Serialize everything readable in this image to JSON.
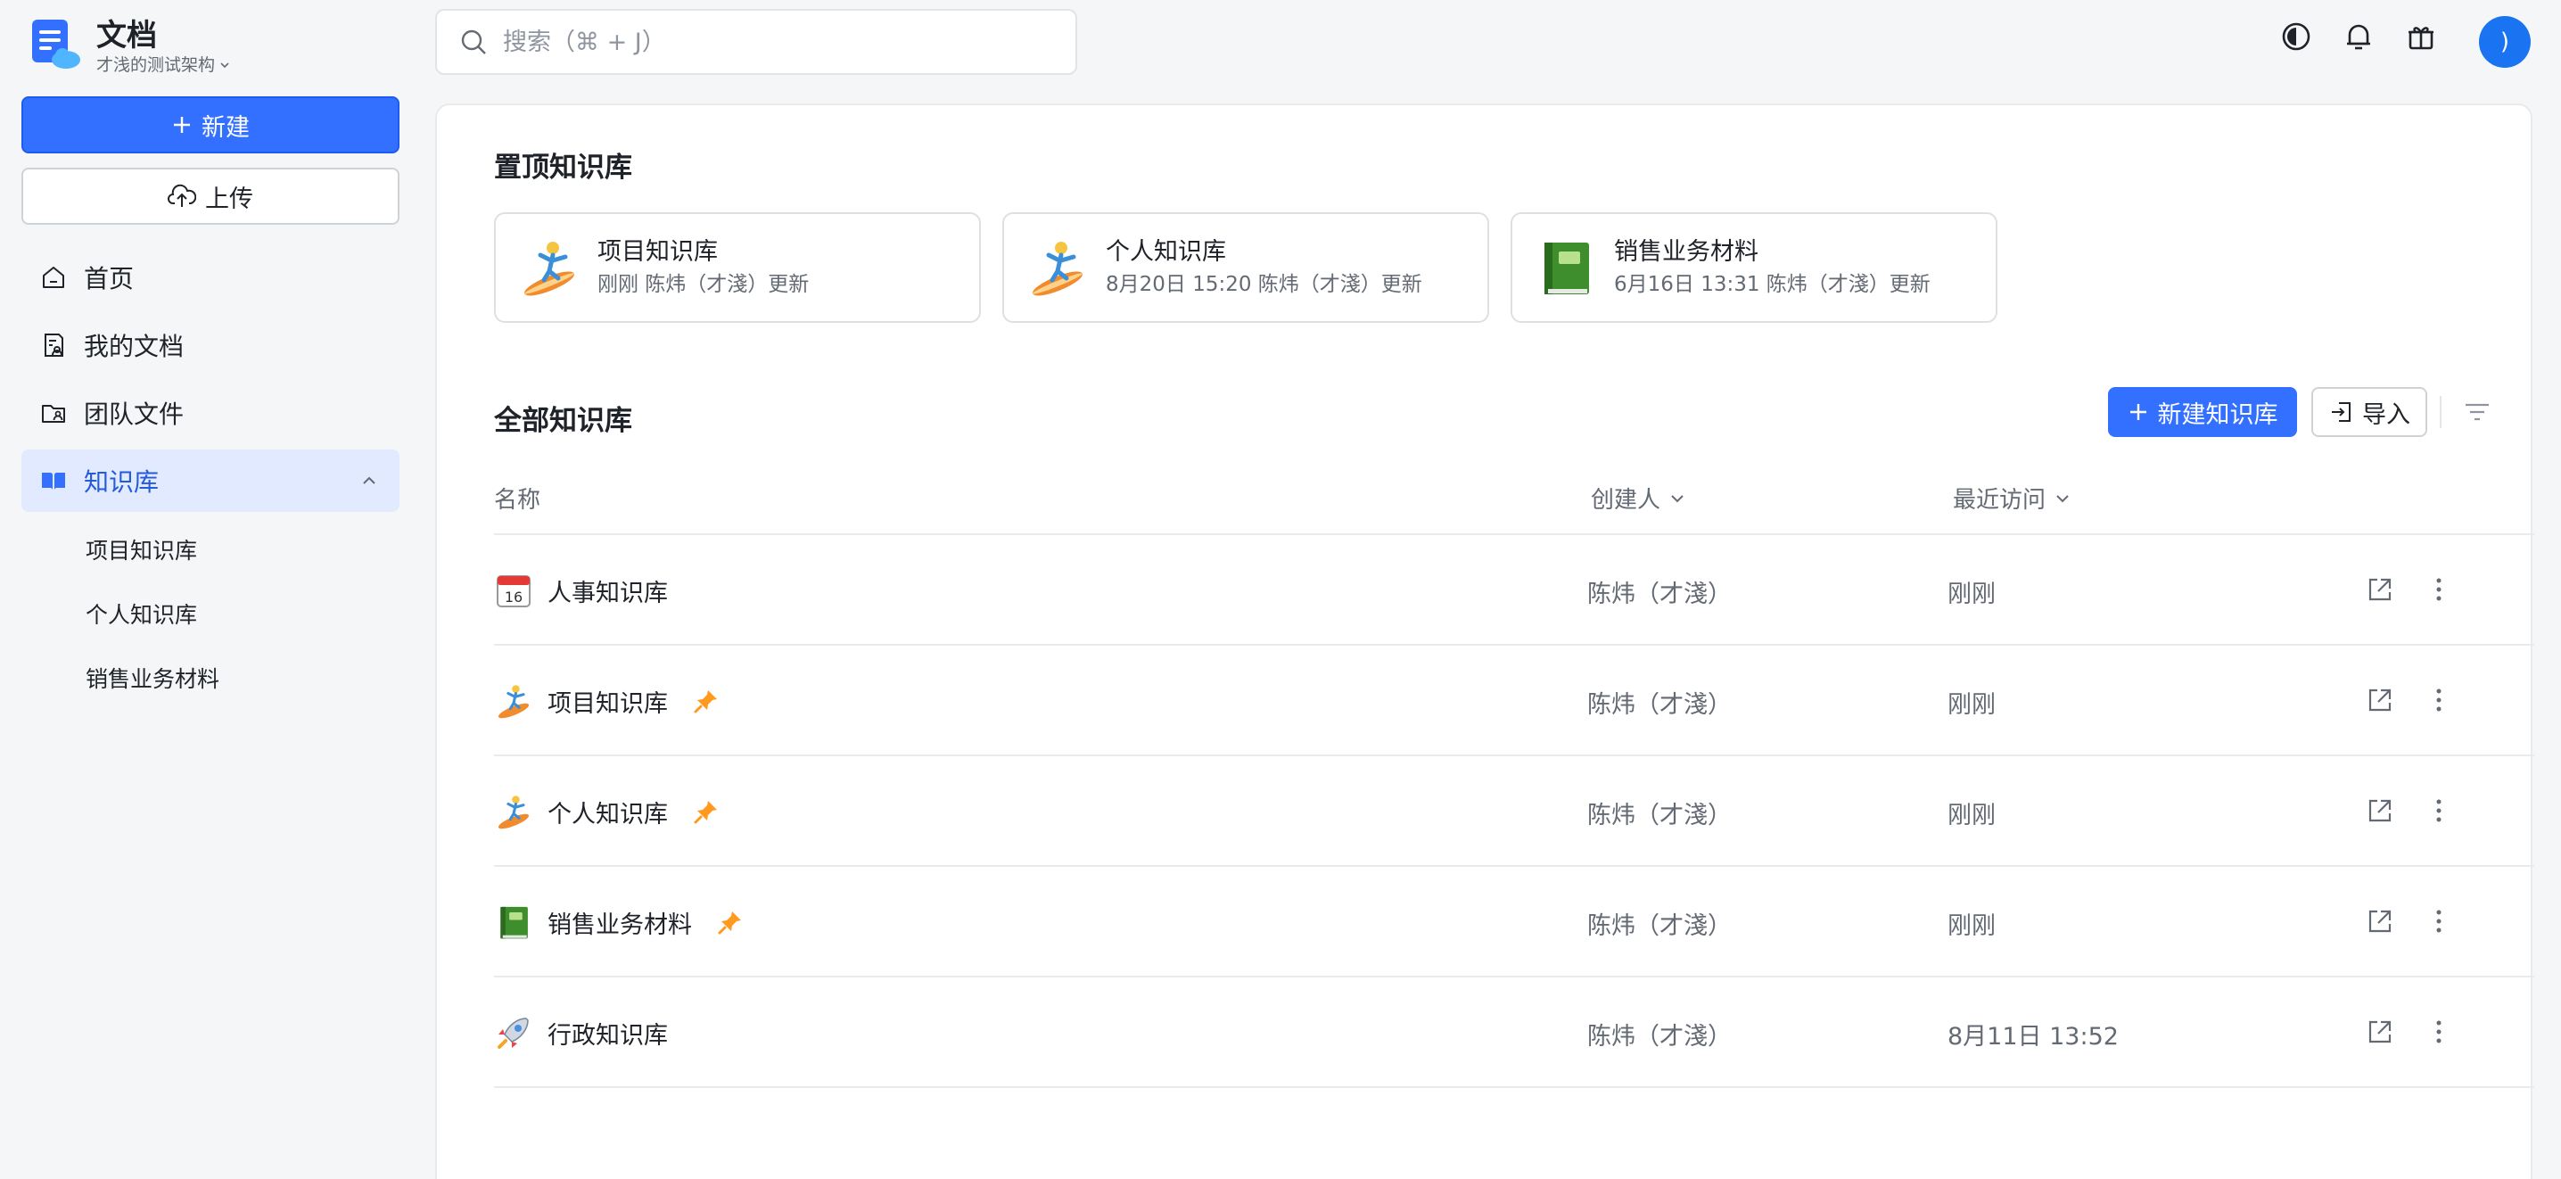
{
  "app": {
    "title": "文档",
    "org": "才浅的测试架构"
  },
  "sidebar": {
    "new_label": "新建",
    "upload_label": "上传",
    "items": [
      {
        "label": "首页"
      },
      {
        "label": "我的文档"
      },
      {
        "label": "团队文件"
      },
      {
        "label": "知识库"
      }
    ],
    "sub_items": [
      {
        "label": "项目知识库"
      },
      {
        "label": "个人知识库"
      },
      {
        "label": "销售业务材料"
      }
    ]
  },
  "search": {
    "placeholder": "搜索（⌘ + J）"
  },
  "top_icons": [
    "theme-icon",
    "bell-icon",
    "gift-icon"
  ],
  "avatar": {
    "text": ")"
  },
  "pinned": {
    "title": "置顶知识库",
    "cards": [
      {
        "name": "项目知识库",
        "meta": "刚刚 陈炜（才淺）更新",
        "icon": "surfer-icon"
      },
      {
        "name": "个人知识库",
        "meta": "8月20日 15:20 陈炜（才淺）更新",
        "icon": "surfer-icon"
      },
      {
        "name": "销售业务材料",
        "meta": "6月16日 13:31 陈炜（才淺）更新",
        "icon": "green-book-icon"
      }
    ]
  },
  "all": {
    "title": "全部知识库",
    "create_label": "新建知识库",
    "import_label": "导入",
    "columns": {
      "name": "名称",
      "creator": "创建人",
      "visited": "最近访问"
    },
    "rows": [
      {
        "name": "人事知识库",
        "creator": "陈炜（才淺）",
        "visited": "刚刚",
        "icon": "calendar-icon",
        "pinned": false
      },
      {
        "name": "项目知识库",
        "creator": "陈炜（才淺）",
        "visited": "刚刚",
        "icon": "surfer-icon",
        "pinned": true
      },
      {
        "name": "个人知识库",
        "creator": "陈炜（才淺）",
        "visited": "刚刚",
        "icon": "surfer-icon",
        "pinned": true
      },
      {
        "name": "销售业务材料",
        "creator": "陈炜（才淺）",
        "visited": "刚刚",
        "icon": "green-book-icon",
        "pinned": true
      },
      {
        "name": "行政知识库",
        "creator": "陈炜（才淺）",
        "visited": "8月11日 13:52",
        "icon": "rocket-icon",
        "pinned": false
      }
    ]
  },
  "colors": {
    "accent": "#3370ff",
    "active_bg": "#e1eaff",
    "pin": "#ff9a1f"
  }
}
